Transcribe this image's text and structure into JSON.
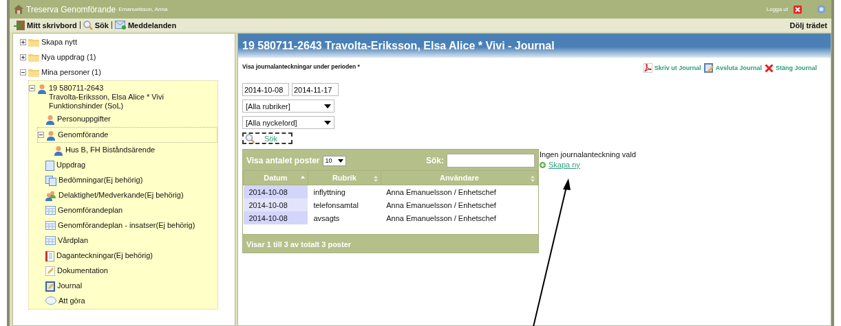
{
  "title_bar": {
    "app_name": "Treserva Genomförande",
    "user": "Emanuelsson, Anna",
    "logout": "Logga ut"
  },
  "toolbar": {
    "items": [
      "Mitt skrivbord",
      "Sök",
      "Meddelanden"
    ],
    "hide_tree": "Dölj trädet"
  },
  "tree": [
    {
      "kind": "folder",
      "label": "Skapa nytt",
      "expanded": false
    },
    {
      "kind": "folder",
      "label": "Nya uppdrag (1)",
      "expanded": false
    },
    {
      "kind": "folder",
      "label": "Mina personer (1)",
      "expanded": true,
      "children": [
        {
          "kind": "person",
          "lines": [
            "19 580711-2643",
            "Travolta-Eriksson, Elsa Alice * Vivi",
            "Funktionshinder (SoL)"
          ],
          "expanded": true,
          "highlighted": true,
          "children": [
            {
              "kind": "person",
              "label": "Personuppgifter"
            },
            {
              "kind": "person",
              "label": "Genomförande",
              "expanded": true,
              "selected": true,
              "children": [
                {
                  "kind": "person",
                  "label": "Hus B, FH Biståndsärende"
                }
              ]
            },
            {
              "kind": "page",
              "label": "Uppdrag"
            },
            {
              "kind": "pages",
              "label": "Bedömningar(Ej behörig)"
            },
            {
              "kind": "group",
              "label": "Delaktighet/Medverkande(Ej behörig)"
            },
            {
              "kind": "table",
              "label": "Genomförandeplan"
            },
            {
              "kind": "table",
              "label": "Genomförandeplan - insatser(Ej behörig)"
            },
            {
              "kind": "table",
              "label": "Vårdplan"
            },
            {
              "kind": "notes",
              "label": "Daganteckningar(Ej behörig)"
            },
            {
              "kind": "pencil",
              "label": "Dokumentation"
            },
            {
              "kind": "journal",
              "label": "Journal"
            },
            {
              "kind": "bubble",
              "label": "Att göra"
            }
          ]
        }
      ]
    }
  ],
  "main": {
    "title": "19 580711-2643 Travolta-Eriksson, Elsa Alice * Vivi - Journal",
    "period_label": "Visa journalanteckningar under perioden *",
    "actions": [
      {
        "kind": "pdf",
        "label": "Skriv ut Journal"
      },
      {
        "kind": "edit",
        "label": "Avsluta Journal"
      },
      {
        "kind": "close",
        "label": "Stäng Journal"
      }
    ],
    "date_from": "2014-10-08",
    "date_to": "2014-11-17",
    "selects": [
      "[Alla rubriker]",
      "[Alla nyckelord]"
    ],
    "search_button": "Sök",
    "table": {
      "length_label": "Visa antalet poster",
      "length_value": "10",
      "search_label": "Sök:",
      "columns": [
        {
          "label": "Datum",
          "sorted": true
        },
        {
          "label": "Rubrik",
          "sorted": false
        },
        {
          "label": "Användare",
          "sorted": false
        }
      ],
      "rows": [
        [
          "2014-10-08",
          "inflyttning",
          "Anna Emanuelsson / Enhetschef"
        ],
        [
          "2014-10-08",
          "telefonsamtal",
          "Anna Emanuelsson / Enhetschef"
        ],
        [
          "2014-10-08",
          "avsagts",
          "Anna Emanuelsson / Enhetschef"
        ]
      ],
      "footer": "Visar 1 till 3 av totalt 3 poster"
    },
    "empty_message": "Ingen journalanteckning vald",
    "create_link": "Skapa ny"
  }
}
